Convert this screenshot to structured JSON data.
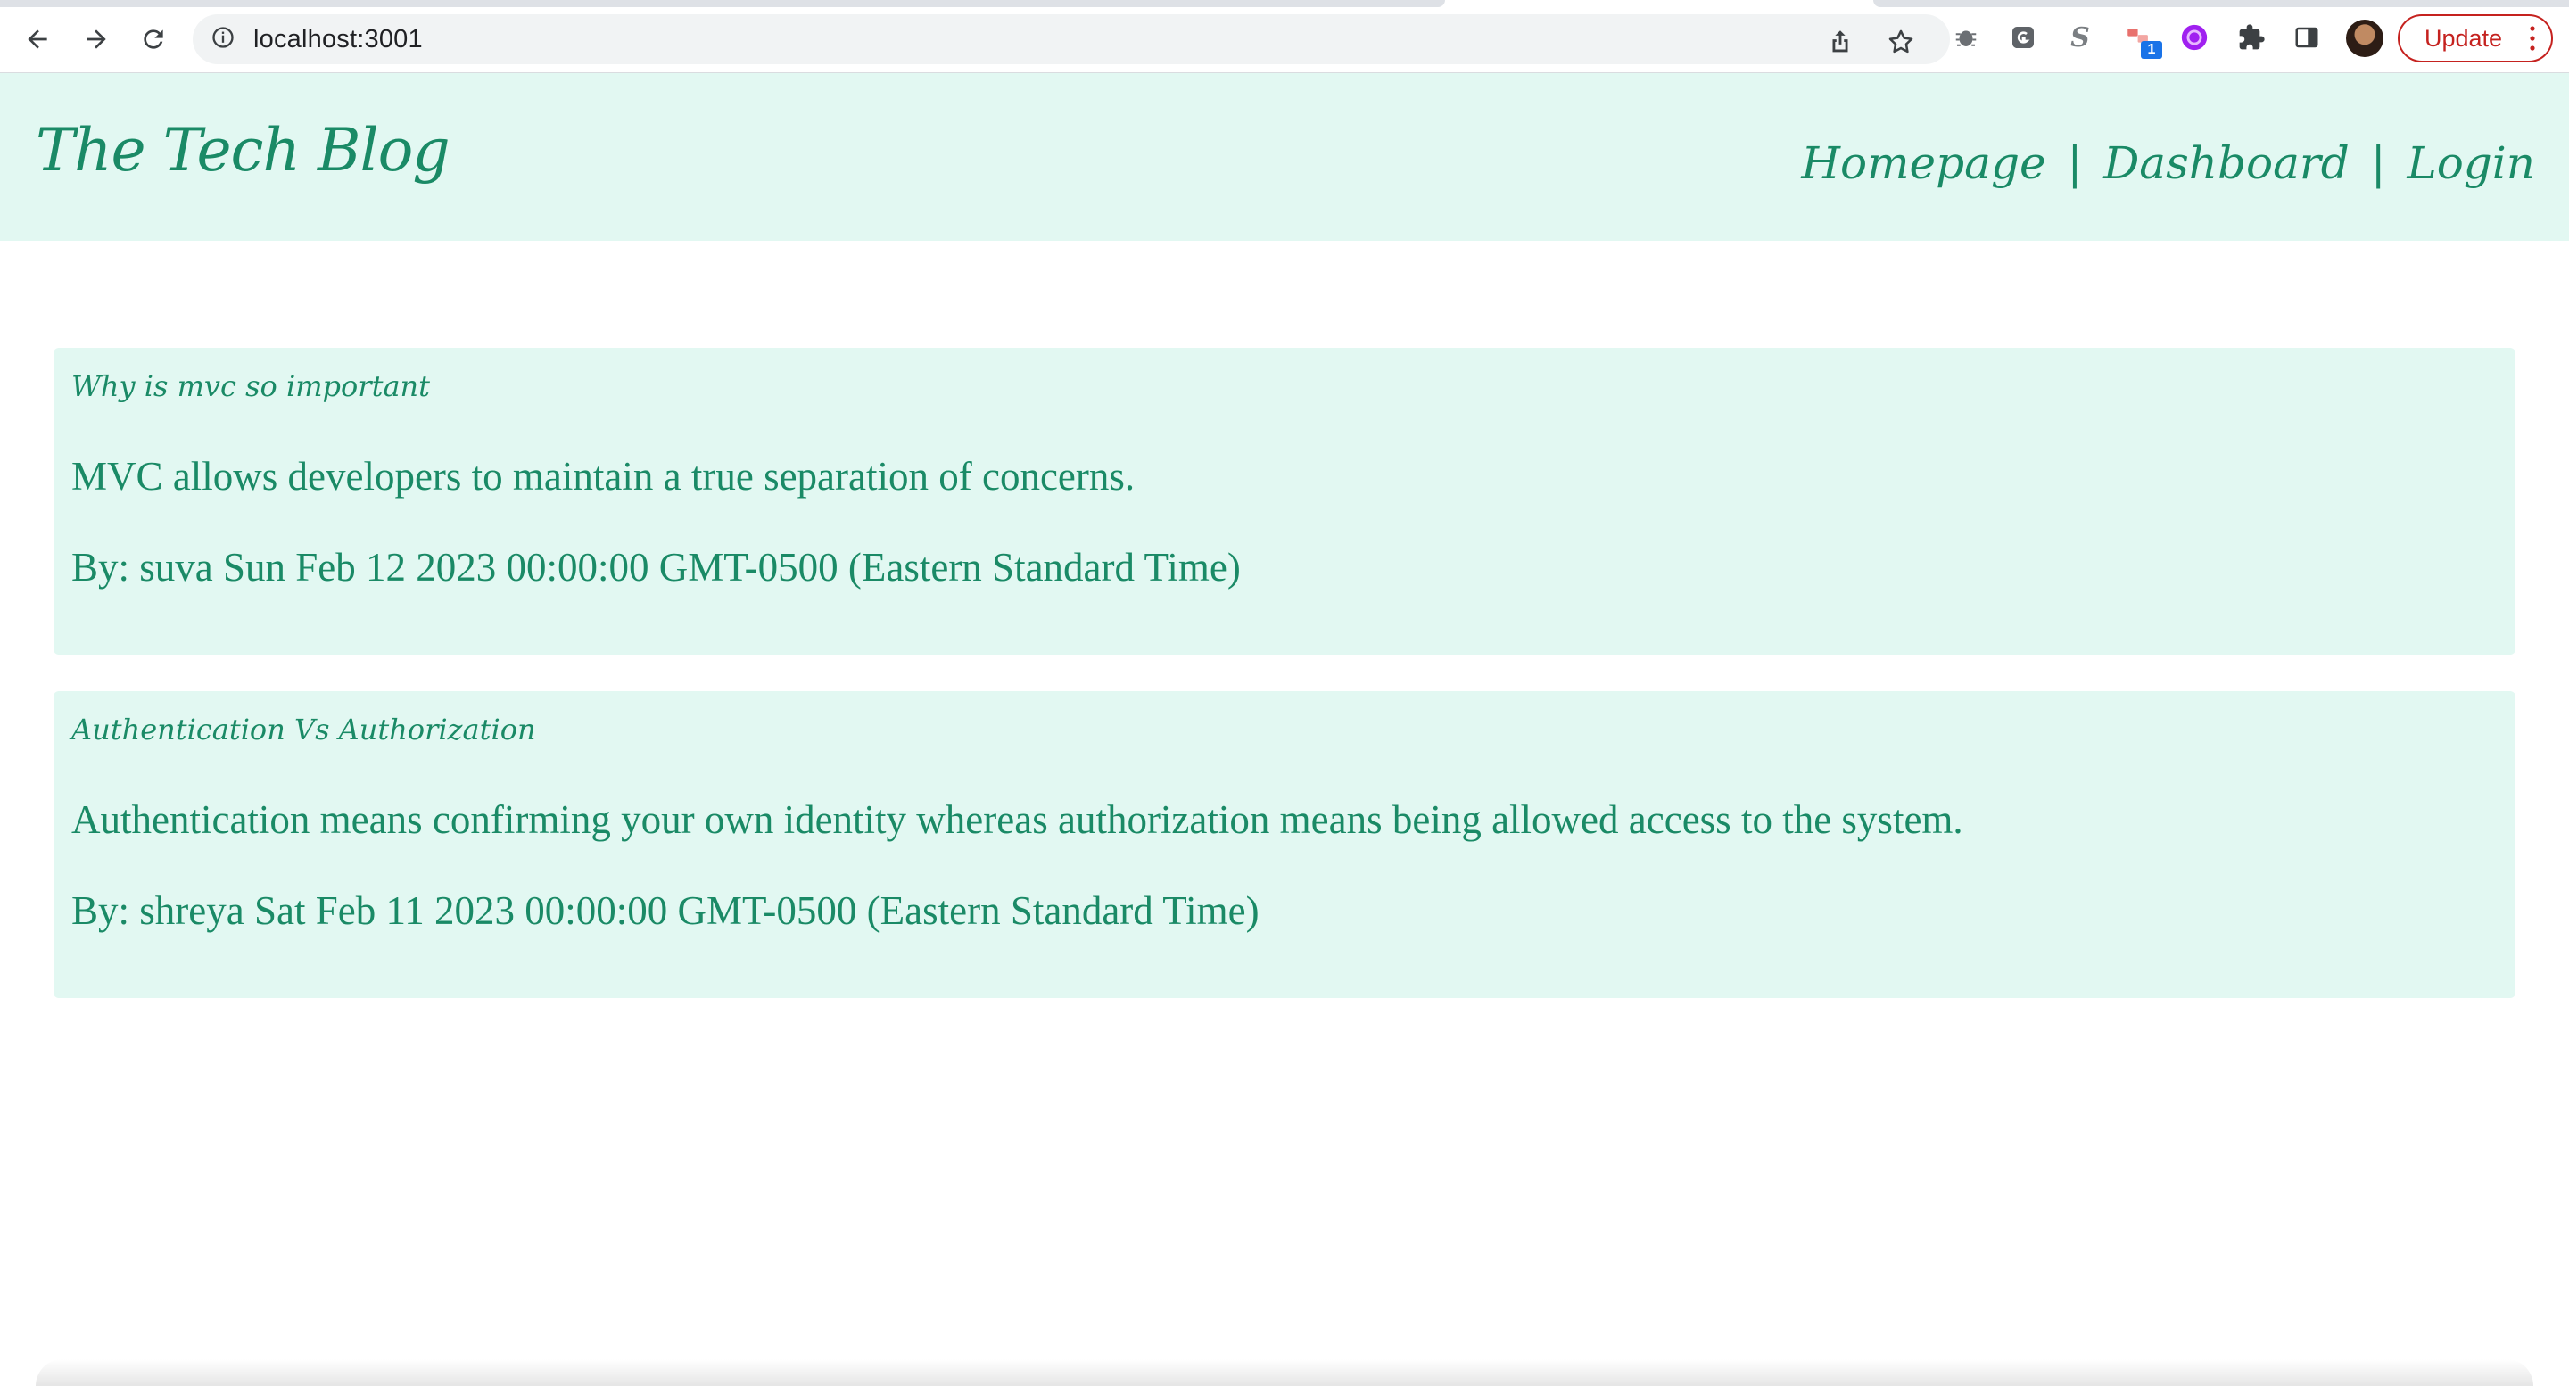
{
  "browser": {
    "url": "localhost:3001",
    "update_label": "Update",
    "extension_badge": "1",
    "extensions": [
      "bug-icon",
      "grammar-icon",
      "s-icon",
      "puzzle-badge-icon",
      "purple-circle-icon",
      "extensions-icon",
      "side-panel-icon"
    ],
    "accent_color": "#c5221f"
  },
  "header": {
    "brand": "The Tech Blog",
    "nav": {
      "homepage": "Homepage",
      "dashboard": "Dashboard",
      "login": "Login",
      "separator": "|"
    }
  },
  "posts": [
    {
      "title": "Why is mvc so important",
      "body": "MVC allows developers to maintain a true separation of concerns.",
      "meta": "By: suva Sun Feb 12 2023 00:00:00 GMT-0500 (Eastern Standard Time)"
    },
    {
      "title": "Authentication Vs Authorization",
      "body": "Authentication means confirming your own identity whereas authorization means being allowed access to the system.",
      "meta": "By: shreya Sat Feb 11 2023 00:00:00 GMT-0500 (Eastern Standard Time)"
    }
  ],
  "colors": {
    "theme_bg": "#e2f8f2",
    "theme_text": "#1a8a66"
  }
}
